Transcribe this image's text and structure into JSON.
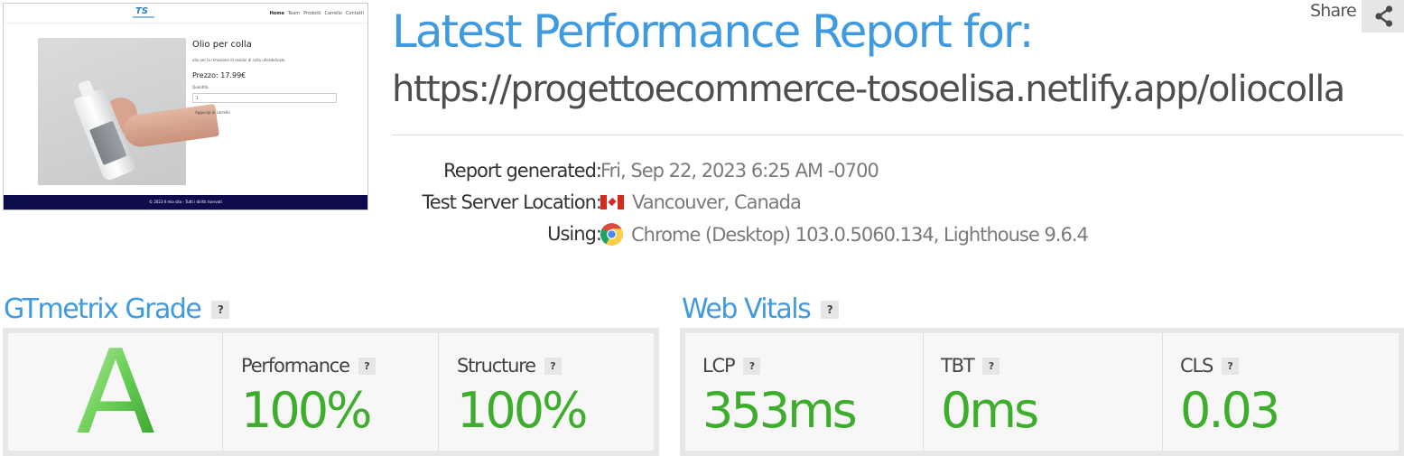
{
  "thumbnail": {
    "nav_links": [
      "Home",
      "Team",
      "Prodotti",
      "Carrello",
      "Contatti"
    ],
    "product_title": "Olio per colla",
    "product_desc": "olio per la rimozione di residui di colla ultradelicato",
    "product_price": "Prezzo: 17.99€",
    "qty_label": "Quantità",
    "qty_value": "1",
    "add_to_cart": "Aggiungi al carrello",
    "footer": "© 2023 Il mio sito - Tutti i diritti riservati"
  },
  "header": {
    "title": "Latest Performance Report for:",
    "url": "https://progettoecommerce-tosoelisa.netlify.app/oliocolla",
    "share_label": "Share"
  },
  "meta": {
    "generated_label": "Report generated:",
    "generated_value": "Fri, Sep 22, 2023 6:25 AM -0700",
    "location_label": "Test Server Location:",
    "location_value": "Vancouver, Canada",
    "using_label": "Using:",
    "using_value": "Chrome (Desktop) 103.0.5060.134, Lighthouse 9.6.4"
  },
  "grade_section": {
    "title": "GTmetrix Grade",
    "help": "?",
    "grade": "A",
    "performance_label": "Performance",
    "performance_value": "100%",
    "structure_label": "Structure",
    "structure_value": "100%"
  },
  "vitals_section": {
    "title": "Web Vitals",
    "help": "?",
    "lcp_label": "LCP",
    "lcp_value": "353ms",
    "tbt_label": "TBT",
    "tbt_value": "0ms",
    "cls_label": "CLS",
    "cls_value": "0.03"
  },
  "colors": {
    "title_blue": "#3f9ae0",
    "grade_green": "#3dae2b",
    "panel_bg": "#f7f7f7"
  }
}
